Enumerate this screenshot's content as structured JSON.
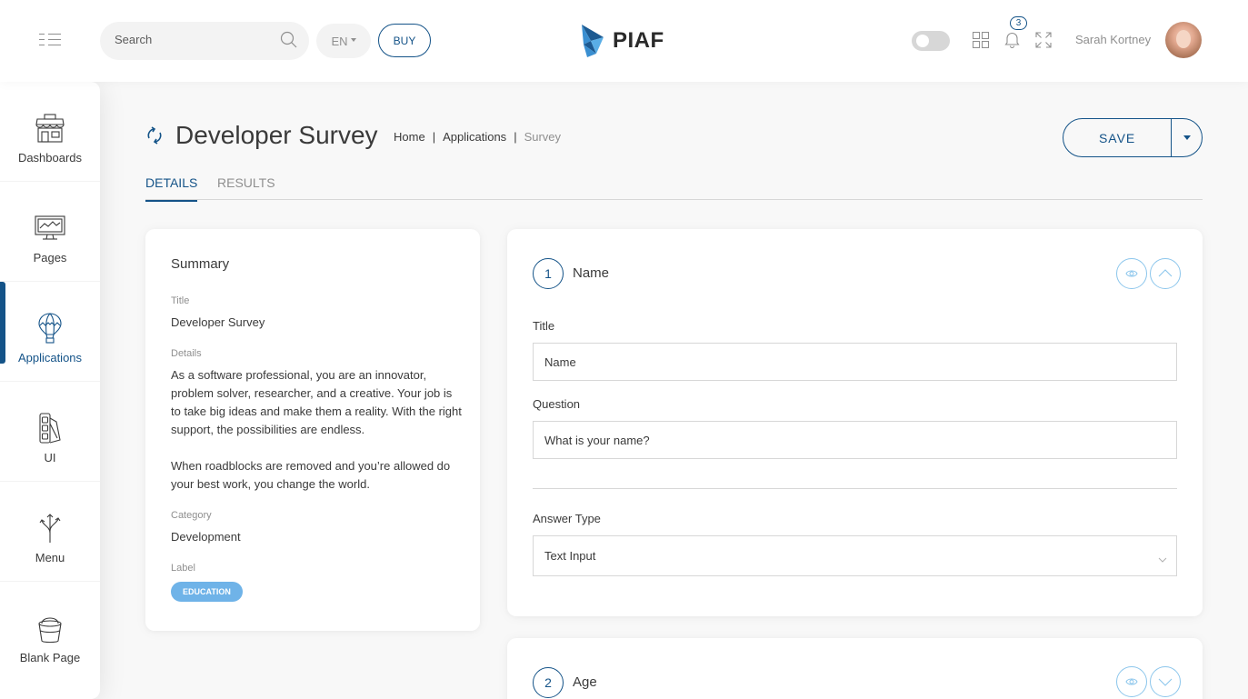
{
  "header": {
    "search_placeholder": "Search",
    "language": "EN",
    "buy_label": "BUY",
    "logo_text": "PIAF",
    "notification_count": "3",
    "user_name": "Sarah Kortney"
  },
  "sidebar": {
    "items": [
      {
        "label": "Dashboards",
        "icon": "shop-icon"
      },
      {
        "label": "Pages",
        "icon": "monitor-icon"
      },
      {
        "label": "Applications",
        "icon": "air-balloon-icon",
        "active": true
      },
      {
        "label": "UI",
        "icon": "pantone-icon"
      },
      {
        "label": "Menu",
        "icon": "three-arrows-icon"
      },
      {
        "label": "Blank Page",
        "icon": "bucket-icon"
      }
    ]
  },
  "page": {
    "title": "Developer Survey",
    "breadcrumb": [
      "Home",
      "Applications",
      "Survey"
    ],
    "save_label": "SAVE",
    "tabs": [
      "DETAILS",
      "RESULTS"
    ]
  },
  "summary": {
    "heading": "Summary",
    "title_label": "Title",
    "title_value": "Developer Survey",
    "details_label": "Details",
    "details_p1": "As a software professional, you are an innovator, problem solver, researcher, and a creative. Your job is to take big ideas and make them a reality. With the right support, the possibilities are endless.",
    "details_p2": "When roadblocks are removed and you’re allowed do your best work, you change the world.",
    "category_label": "Category",
    "category_value": "Development",
    "label_label": "Label",
    "label_value": "EDUCATION"
  },
  "questions": [
    {
      "number": "1",
      "title": "Name",
      "title_field_label": "Title",
      "title_field_value": "Name",
      "question_field_label": "Question",
      "question_field_value": "What is your name?",
      "answer_type_label": "Answer Type",
      "answer_type_value": "Text Input"
    },
    {
      "number": "2",
      "title": "Age"
    }
  ],
  "colors": {
    "accent": "#145388",
    "tag": "#6fb3e8",
    "muted": "#8f8f8f",
    "background": "#f8f8f8"
  }
}
